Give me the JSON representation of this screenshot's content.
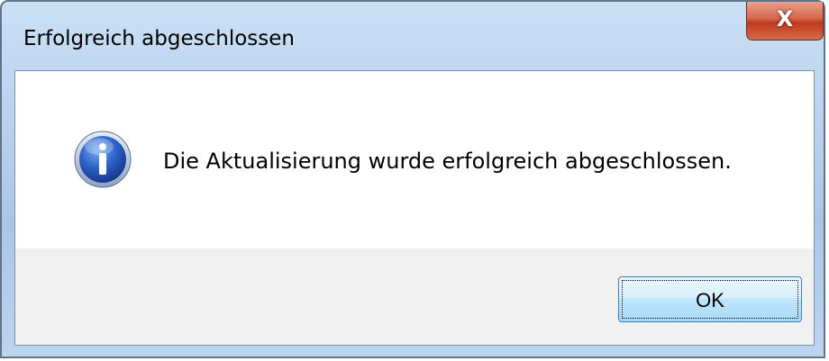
{
  "window": {
    "title": "Erfolgreich abgeschlossen",
    "close_icon": "close-icon",
    "close_glyph": "X",
    "frame_color": "#b7d1ec",
    "close_color": "#c13a1d"
  },
  "message": {
    "icon": "info-icon",
    "text": "Die Aktualisierung wurde erfolgreich abgeschlossen."
  },
  "buttons": {
    "ok_label": "OK"
  }
}
